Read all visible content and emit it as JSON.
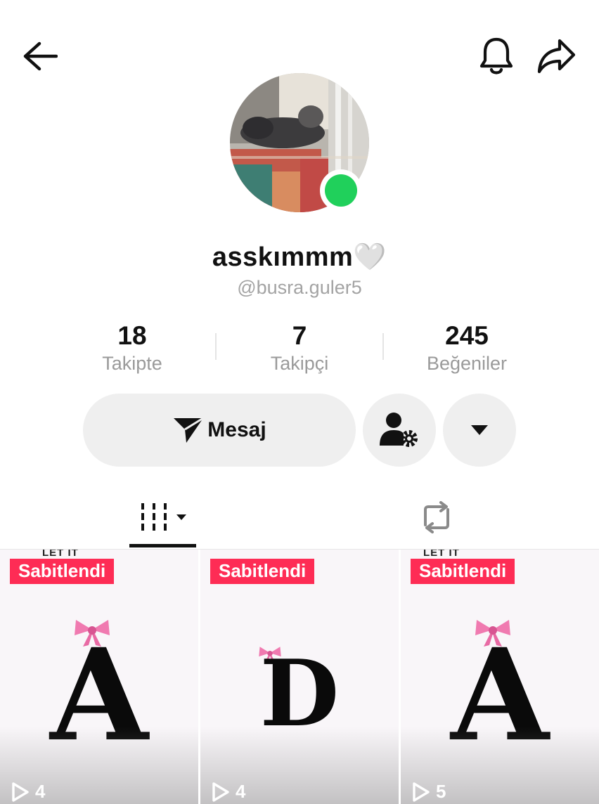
{
  "profile": {
    "display_name": "asskımmm🤍",
    "username": "@busra.guler5",
    "online": true
  },
  "stats": [
    {
      "value": "18",
      "label": "Takipte"
    },
    {
      "value": "7",
      "label": "Takipçi"
    },
    {
      "value": "245",
      "label": "Beğeniler"
    }
  ],
  "actions": {
    "message_label": "Mesaj"
  },
  "icons": {
    "back": "arrow-left-icon",
    "notifications": "bell-icon",
    "share": "share-arrow-icon",
    "message": "send-icon",
    "friends": "user-settings-icon",
    "more": "caret-down-icon",
    "videos_tab": "grid-lines-icon",
    "reposts_tab": "repost-icon",
    "views": "play-icon"
  },
  "videos": [
    {
      "badge": "Sabitlendi",
      "letter": "A",
      "views": "4",
      "caption_fragment": "LET IT"
    },
    {
      "badge": "Sabitlendi",
      "letter": "D",
      "views": "4",
      "caption_fragment": ""
    },
    {
      "badge": "Sabitlendi",
      "letter": "A",
      "views": "5",
      "caption_fragment": "LET IT"
    }
  ],
  "colors": {
    "pinned_badge": "#fe2c55",
    "online_dot": "#20d05b",
    "bow": "#f07ab0"
  }
}
